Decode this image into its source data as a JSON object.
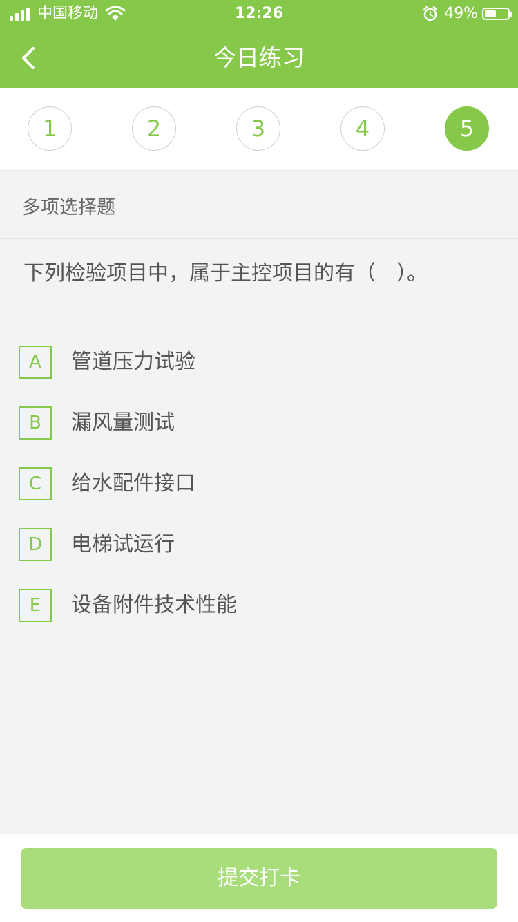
{
  "status_bar": {
    "carrier": "中国移动",
    "time": "12:26",
    "battery_percent": "49%",
    "battery_level": 0.49,
    "icons": [
      "signal-icon",
      "wifi-icon",
      "alarm-icon",
      "battery-icon"
    ]
  },
  "nav": {
    "title": "今日练习",
    "back_icon": "chevron-left-icon"
  },
  "question_numbers": {
    "items": [
      "1",
      "2",
      "3",
      "4",
      "5"
    ],
    "active_index": 4
  },
  "question": {
    "type_label": "多项选择题",
    "stem": "下列检验项目中，属于主控项目的有（　）。",
    "options": [
      {
        "letter": "A",
        "text": "管道压力试验"
      },
      {
        "letter": "B",
        "text": "漏风量测试"
      },
      {
        "letter": "C",
        "text": "给水配件接口"
      },
      {
        "letter": "D",
        "text": "电梯试运行"
      },
      {
        "letter": "E",
        "text": "设备附件技术性能"
      }
    ]
  },
  "footer": {
    "submit_label": "提交打卡"
  },
  "colors": {
    "brand_green": "#86c94a",
    "submit_disabled": "#a9dc7a"
  }
}
